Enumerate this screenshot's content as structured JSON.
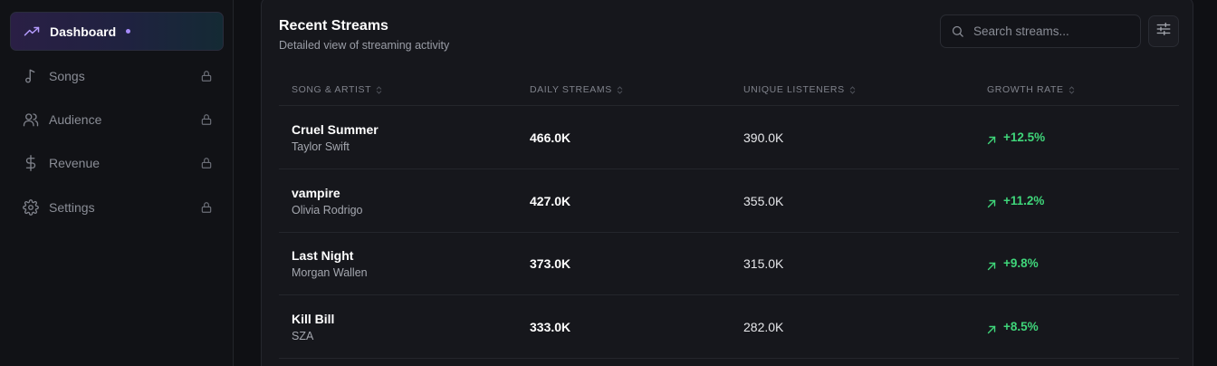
{
  "sidebar": {
    "items": [
      {
        "label": "Dashboard",
        "icon": "trending-up-icon",
        "active": true
      },
      {
        "label": "Songs",
        "icon": "music-note-icon",
        "locked": true
      },
      {
        "label": "Audience",
        "icon": "users-icon",
        "locked": true
      },
      {
        "label": "Revenue",
        "icon": "dollar-icon",
        "locked": true
      },
      {
        "label": "Settings",
        "icon": "gear-icon",
        "locked": true
      }
    ]
  },
  "panel": {
    "title": "Recent Streams",
    "subtitle": "Detailed view of streaming activity",
    "search_placeholder": "Search streams..."
  },
  "table": {
    "headers": [
      "SONG & ARTIST",
      "DAILY STREAMS",
      "UNIQUE LISTENERS",
      "GROWTH RATE"
    ],
    "rows": [
      {
        "title": "Cruel Summer",
        "artist": "Taylor Swift",
        "daily": "466.0K",
        "unique": "390.0K",
        "growth": "+12.5%"
      },
      {
        "title": "vampire",
        "artist": "Olivia Rodrigo",
        "daily": "427.0K",
        "unique": "355.0K",
        "growth": "+11.2%"
      },
      {
        "title": "Last Night",
        "artist": "Morgan Wallen",
        "daily": "373.0K",
        "unique": "315.0K",
        "growth": "+9.8%"
      },
      {
        "title": "Kill Bill",
        "artist": "SZA",
        "daily": "333.0K",
        "unique": "282.0K",
        "growth": "+8.5%"
      }
    ]
  },
  "colors": {
    "accent": "#a78bfa",
    "positive": "#3fd67a",
    "background": "#0f1014",
    "panel": "#16171c"
  }
}
